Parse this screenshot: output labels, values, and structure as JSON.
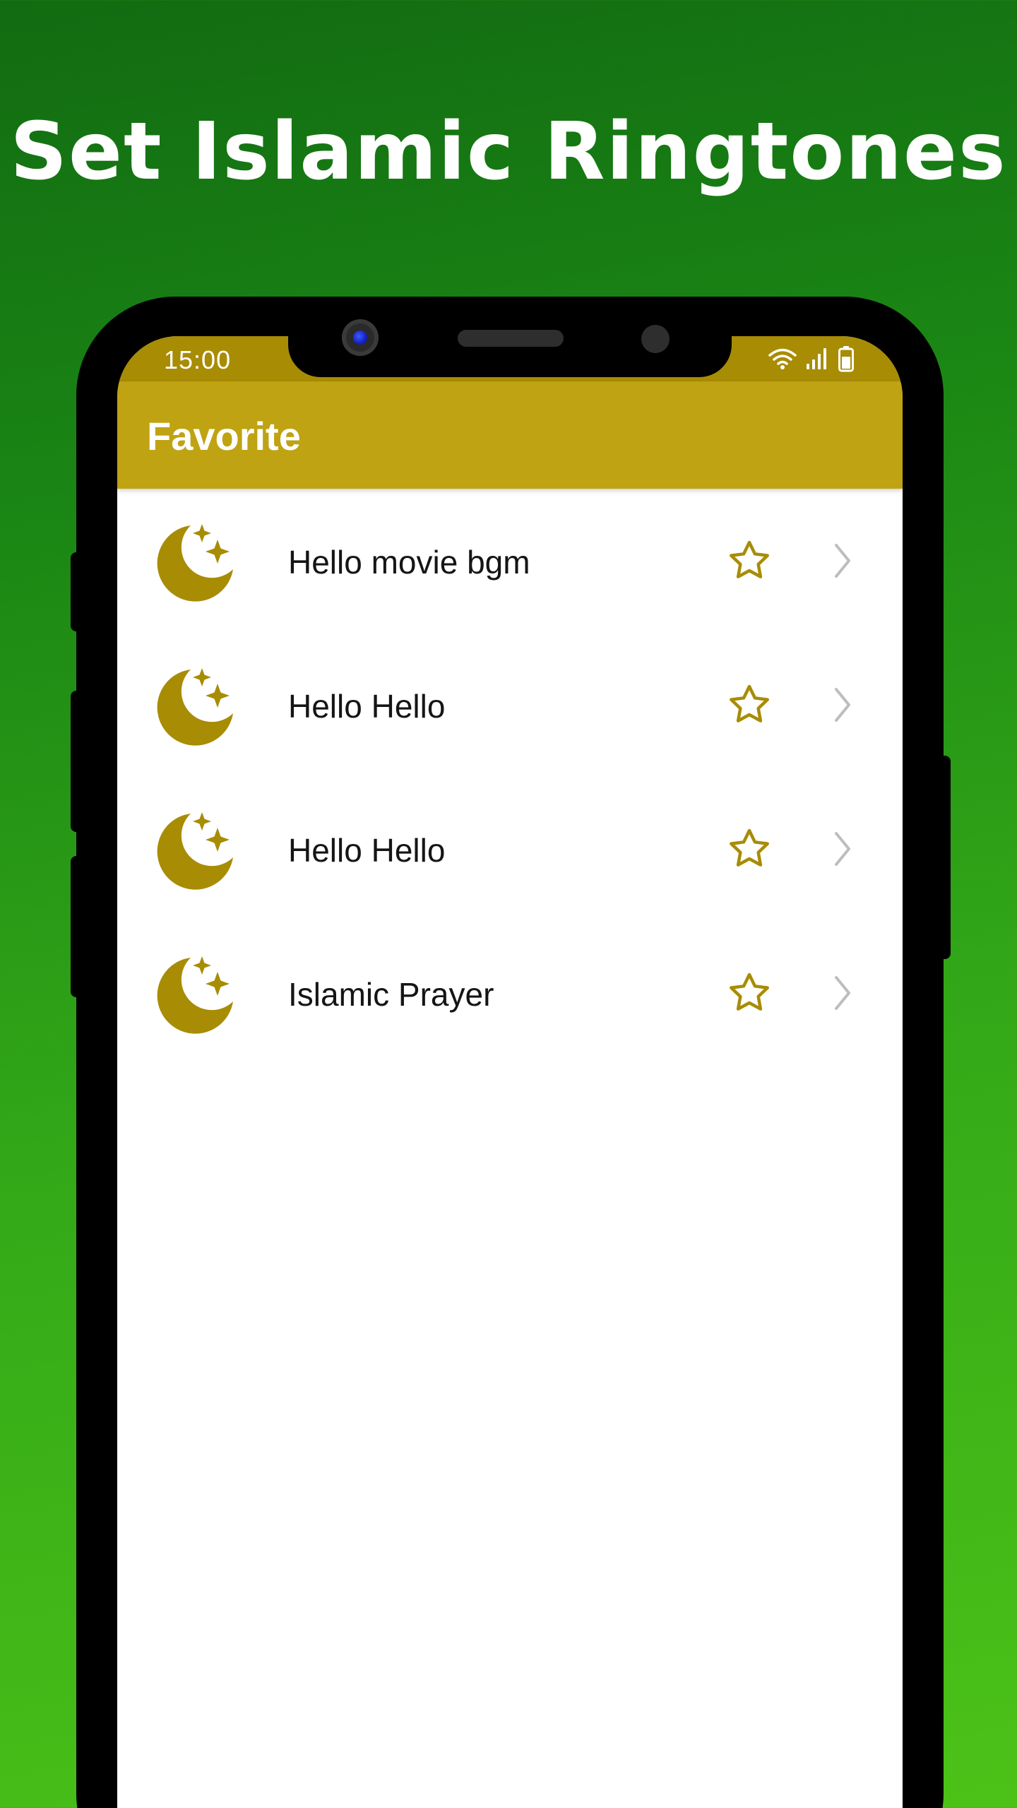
{
  "promo": {
    "headline": "Set Islamic Ringtones"
  },
  "status_bar": {
    "time": "15:00",
    "icons": [
      "wifi-icon",
      "signal-icon",
      "battery-icon"
    ]
  },
  "app_bar": {
    "title": "Favorite"
  },
  "list": {
    "items": [
      {
        "title": "Hello movie bgm",
        "icon": "moon-stars-icon",
        "favorite": true
      },
      {
        "title": "Hello Hello",
        "icon": "moon-stars-icon",
        "favorite": true
      },
      {
        "title": "Hello Hello",
        "icon": "moon-stars-icon",
        "favorite": true
      },
      {
        "title": "Islamic Prayer",
        "icon": "moon-stars-icon",
        "favorite": true
      }
    ]
  },
  "colors": {
    "background_gradient_top": "#126b12",
    "background_gradient_bottom": "#4cc218",
    "status_bar": "#a88c04",
    "app_bar": "#bfa312",
    "accent_gold": "#a88c04",
    "chevron": "#bdbdbd"
  }
}
